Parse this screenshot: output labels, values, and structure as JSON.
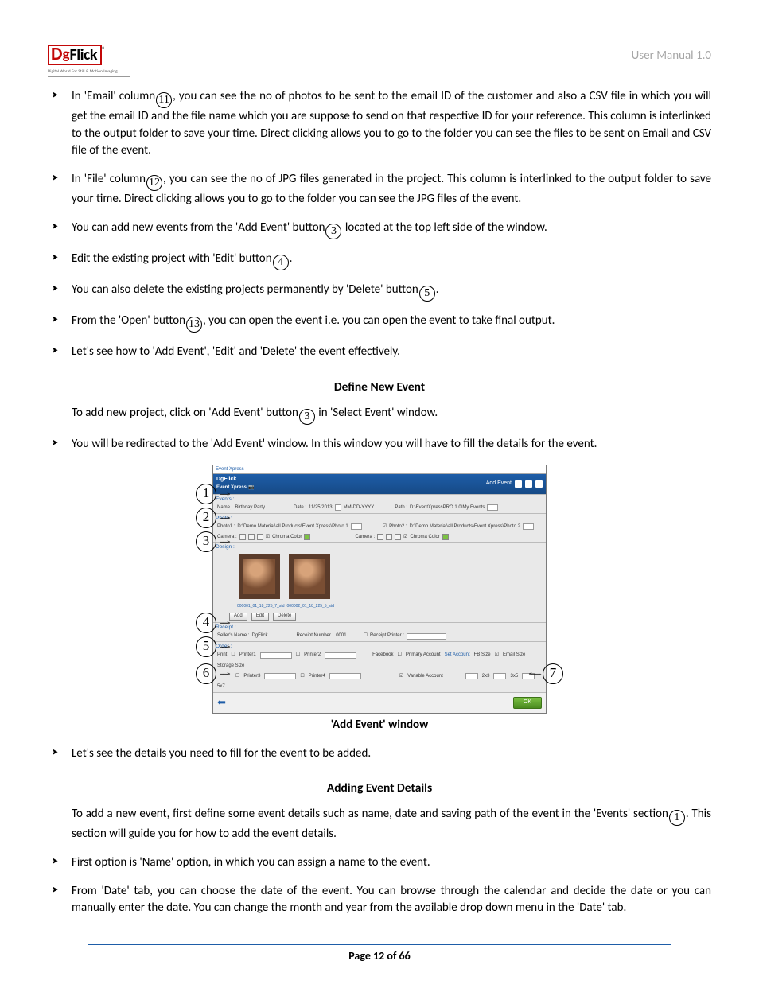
{
  "header": {
    "logo_D": "D",
    "logo_g": "g",
    "logo_flick": "Flick",
    "logo_r": "®",
    "logo_tag": "Digital World For Still & Motion Imaging",
    "user_manual": "User Manual 1.0"
  },
  "bullets1": {
    "b1a": "In 'Email' column",
    "b1b": ", you can see the no of photos to be sent to the email ID of the customer and also a CSV file in which you will get the email ID and the file name which you are suppose to send on that respective ID for your reference. This column is interlinked to the output folder to save your time. Direct clicking allows you to go to the folder you can see the files to be sent on Email and CSV file of the event.",
    "b2a": "In 'File' column",
    "b2b": ", you can see the no of JPG files generated in the project. This column is interlinked to the output folder to save your time. Direct clicking allows you to go to the folder you can see the JPG files of the event.",
    "b3a": "You can add new events from the 'Add Event' button",
    "b3b": " located at the top left side of the window.",
    "b4a": "Edit the existing project with 'Edit' button",
    "b4b": ".",
    "b5a": "You can also delete the existing projects permanently by 'Delete' button",
    "b5b": ".",
    "b6a": "From the 'Open' button",
    "b6b": ", you can open the event i.e. you can open the event to take final output.",
    "b7": "Let's see how to 'Add Event', 'Edit' and 'Delete' the event effectively."
  },
  "h1": "Define New Event",
  "p1a": "To add new project, click on 'Add Event' button",
  "p1b": " in 'Select Event' window.",
  "b8": "You will be redirected to the 'Add Event' window. In this window you will have to fill the details for the event.",
  "callouts": {
    "c1": "1",
    "c2": "2",
    "c3": "3",
    "c4": "4",
    "c5": "5",
    "c6": "6",
    "c7": "7"
  },
  "inline": {
    "n11": "11",
    "n12": "12",
    "n3": "3",
    "n4": "4",
    "n5": "5",
    "n13": "13",
    "n1": "1"
  },
  "ss": {
    "wintitle": "Event Xpress",
    "brand": "DgFlick",
    "subbrand": "Event Xpress",
    "addevent": "Add Event",
    "events": "Events :",
    "name": "Name :",
    "name_v": "Birthday Party",
    "date": "Date :",
    "date_v": "11/25/2013",
    "datefmt": "MM-DD-YYYY",
    "path": "Path :",
    "path_v": "D:\\EventXpressPRO 1.0\\My Events",
    "photo": "Photo :",
    "photo1": "Photo1 :",
    "photo1_v": "D:\\Demo Material\\all Products\\Event Xpress\\Photo 1",
    "photo2": "Photo2 :",
    "photo2_v": "D:\\Demo Material\\all Products\\Event Xpress\\Photo 2",
    "camera": "Camera :",
    "chroma": "Chroma Color",
    "design": "Design :",
    "thumb1": "000001_01_18_225_7_std",
    "thumb2": "000002_01_18_225_5_std",
    "add": "Add",
    "edit": "Edit",
    "delete": "Delete",
    "receipt": "Receipt :",
    "seller": "Seller's Name :",
    "seller_v": "DgFlick",
    "rnum": "Receipt Number :",
    "rnum_v": "0001",
    "rprinter": "Receipt Printer :",
    "order": "Order :",
    "print": "Print",
    "p1": "Printer1",
    "p2": "Printer2",
    "p3": "Printer3",
    "p4": "Printer4",
    "fb": "Facebook",
    "primacc": "Primary Account",
    "setacc": "Set Account",
    "varacc": "Variable Account",
    "fbsize": "FB Size",
    "emailsize": "Email Size",
    "storagesize": "Storage Size",
    "s1": "2x3",
    "s2": "3x5",
    "s3": "5x7",
    "ok": "OK"
  },
  "figcap": "'Add Event' window",
  "b9": "Let's see the details you need to fill for the event to be added.",
  "h2": "Adding Event Details",
  "p2a": "To add a new event, first define some event details such as name, date and saving path of the event in the 'Events' section",
  "p2b": ". This section will guide you for how to add the event details.",
  "b10": "First option is 'Name' option, in which you can assign a name to the event.",
  "b11": "From 'Date' tab, you can choose the date of the event. You can browse through the calendar and decide the date or you can manually enter the date. You can change the month and year from the available drop down menu in the 'Date' tab.",
  "footer": {
    "page": "Page ",
    "num": "12",
    "of": " of ",
    "tot": "66"
  }
}
